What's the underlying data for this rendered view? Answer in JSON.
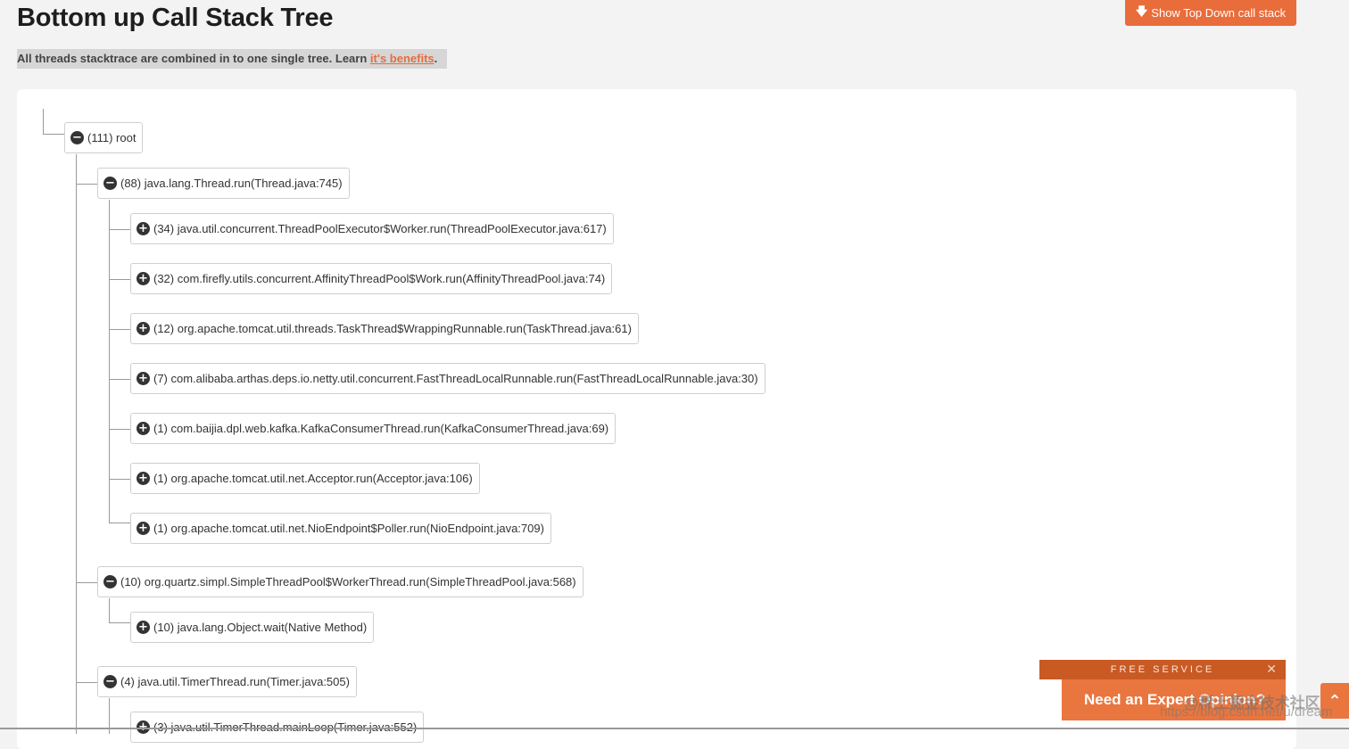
{
  "page": {
    "title": "Bottom up Call Stack Tree",
    "topdown_button_label": "Show Top Down call stack",
    "intro_text": "All threads stacktrace are combined in to one single tree. Learn ",
    "intro_link": "it's benefits",
    "intro_end": "."
  },
  "tree": {
    "nodes": [
      {
        "label": "(111) root",
        "expanded": true
      },
      {
        "label": "(88) java.lang.Thread.run(Thread.java:745)",
        "expanded": true
      },
      {
        "label": "(34) java.util.concurrent.ThreadPoolExecutor$Worker.run(ThreadPoolExecutor.java:617)",
        "expanded": false
      },
      {
        "label": "(32) com.firefly.utils.concurrent.AffinityThreadPool$Work.run(AffinityThreadPool.java:74)",
        "expanded": false
      },
      {
        "label": "(12) org.apache.tomcat.util.threads.TaskThread$WrappingRunnable.run(TaskThread.java:61)",
        "expanded": false
      },
      {
        "label": "(7) com.alibaba.arthas.deps.io.netty.util.concurrent.FastThreadLocalRunnable.run(FastThreadLocalRunnable.java:30)",
        "expanded": false
      },
      {
        "label": "(1) com.baijia.dpl.web.kafka.KafkaConsumerThread.run(KafkaConsumerThread.java:69)",
        "expanded": false
      },
      {
        "label": "(1) org.apache.tomcat.util.net.Acceptor.run(Acceptor.java:106)",
        "expanded": false
      },
      {
        "label": "(1) org.apache.tomcat.util.net.NioEndpoint$Poller.run(NioEndpoint.java:709)",
        "expanded": false
      },
      {
        "label": "(10) org.quartz.simpl.SimpleThreadPool$WorkerThread.run(SimpleThreadPool.java:568)",
        "expanded": true
      },
      {
        "label": "(10) java.lang.Object.wait(Native Method)",
        "expanded": false
      },
      {
        "label": "(4) java.util.TimerThread.run(Timer.java:505)",
        "expanded": true
      },
      {
        "label": "(3) java.util.TimerThread.mainLoop(Timer.java:552)",
        "expanded": false
      }
    ],
    "minus_glyph": "−",
    "plus_glyph": "+"
  },
  "promo": {
    "free_label": "FREE SERVICE",
    "close_glyph": "✕",
    "expert_label": "Need an Expert Opinion?",
    "scroll_top_glyph": "⌃"
  },
  "watermark": {
    "line1": "@稀土掘金技术社区",
    "line2": "https://blog.csdn.net/u/dream"
  },
  "colors": {
    "accent": "#e96c3b",
    "accent_dark": "#c95a24",
    "panel": "#ffffff",
    "background": "#f3f3f3"
  }
}
